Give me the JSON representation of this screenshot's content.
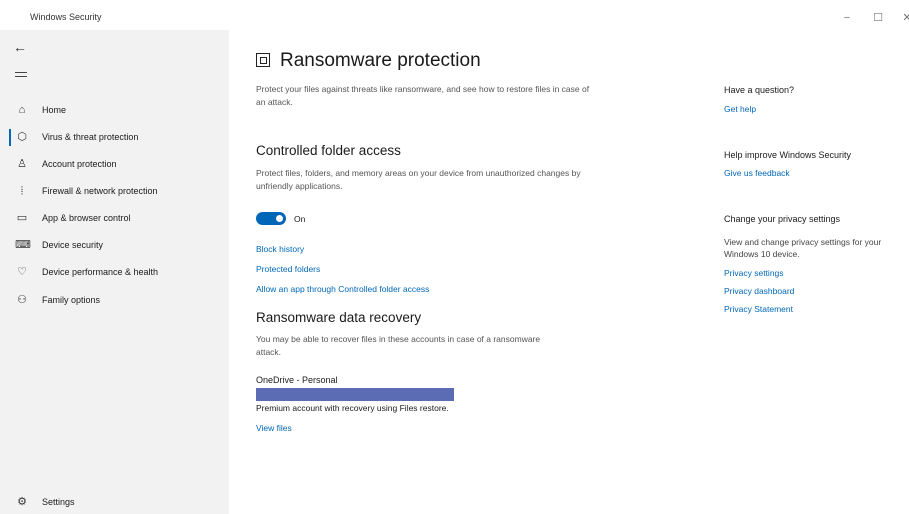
{
  "window": {
    "title": "Windows Security",
    "minimize": "−",
    "maximize": "☐",
    "close": "✕"
  },
  "sidebar": {
    "back_icon": "←",
    "items": [
      {
        "label": "Home",
        "icon": "⌂",
        "icon_name": "home-icon"
      },
      {
        "label": "Virus & threat protection",
        "icon": "⬡",
        "icon_name": "shield-icon",
        "active": true
      },
      {
        "label": "Account protection",
        "icon": "♙",
        "icon_name": "person-icon"
      },
      {
        "label": "Firewall & network protection",
        "icon": "⦙",
        "icon_name": "wifi-icon"
      },
      {
        "label": "App & browser control",
        "icon": "▭",
        "icon_name": "browser-icon"
      },
      {
        "label": "Device security",
        "icon": "⌨",
        "icon_name": "laptop-icon"
      },
      {
        "label": "Device performance & health",
        "icon": "♡",
        "icon_name": "heart-icon"
      },
      {
        "label": "Family options",
        "icon": "⚇",
        "icon_name": "family-icon"
      }
    ],
    "settings": {
      "label": "Settings",
      "icon": "⚙",
      "icon_name": "gear-icon"
    }
  },
  "main": {
    "title": "Ransomware protection",
    "description": "Protect your files against threats like ransomware, and see how to restore files in case of an attack.",
    "cfa": {
      "title": "Controlled folder access",
      "description": "Protect files, folders, and memory areas on your device from unauthorized changes by unfriendly applications.",
      "toggle_label": "On",
      "toggle_on": true,
      "links": {
        "block_history": "Block history",
        "protected_folders": "Protected folders",
        "allow_app": "Allow an app through Controlled folder access"
      }
    },
    "recovery": {
      "title": "Ransomware data recovery",
      "description": "You may be able to recover files in these accounts in case of a ransomware attack.",
      "account_name": "OneDrive - Personal",
      "account_desc": "Premium account with recovery using Files restore.",
      "view_files": "View files"
    }
  },
  "right": {
    "question": {
      "heading": "Have a question?",
      "link": "Get help"
    },
    "improve": {
      "heading": "Help improve Windows Security",
      "link": "Give us feedback"
    },
    "privacy": {
      "heading": "Change your privacy settings",
      "text": "View and change privacy settings for your Windows 10 device.",
      "links": [
        "Privacy settings",
        "Privacy dashboard",
        "Privacy Statement"
      ]
    }
  },
  "colors": {
    "accent": "#0067b8",
    "sidebar_bg": "#f2f2f2",
    "redaction": "#5b6bb4"
  }
}
